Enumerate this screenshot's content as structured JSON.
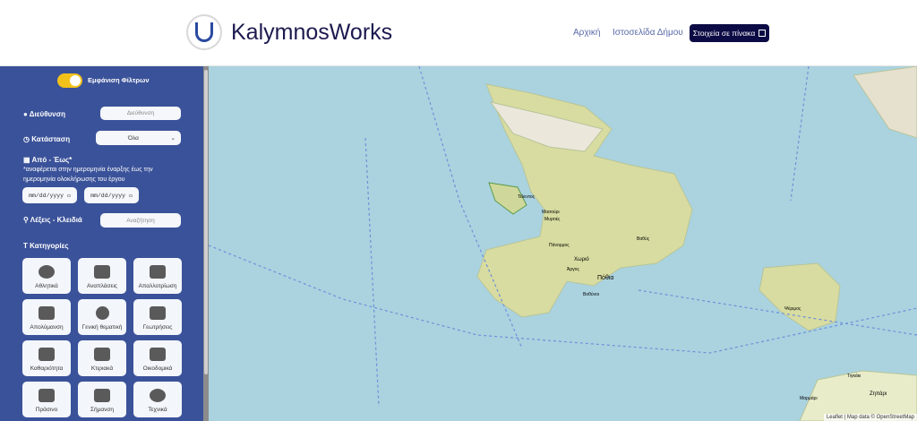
{
  "header": {
    "brand": "KalymnosWorks",
    "nav": [
      "Αρχική",
      "Ιστοσελίδα Δήμου"
    ],
    "table_button": "Στοιχεία σε πίνακα"
  },
  "filters": {
    "toggle_label": "Εμφάνιση Φίλτρων",
    "toggle_on": true,
    "address_label": "Διεύθυνση",
    "address_placeholder": "Διεύθυνση",
    "status_label": "Κατάσταση",
    "status_value": "Όλα",
    "date_label": "Από - Έως*",
    "date_note": "*αναφέρεται στην ημερομηνία έναρξης έως την ημερομηνία ολοκλήρωσης του έργου",
    "date_from_placeholder": "mm/dd/yyyy",
    "date_to_placeholder": "mm/dd/yyyy",
    "keywords_label": "Λέξεις - Κλειδιά",
    "keywords_placeholder": "Αναζήτηση",
    "categories_label": "Κατηγορίες",
    "categories": [
      "Αθλητικά",
      "Αναπλάσεις",
      "Απαλλοτρίωση",
      "Απολύμανση",
      "Γενική θεματική",
      "Γεωτρήσεις",
      "Καθαριότητα",
      "Κτιριακά",
      "Οικοδομικά",
      "Πράσινο",
      "Σήμανση",
      "Τεχνικά"
    ]
  },
  "map": {
    "labels": [
      "Τέλεντος",
      "Μασούρι",
      "Μυρτιές",
      "Πάνορμος",
      "Χωριό",
      "Άργος",
      "Πόθια",
      "Βαθύς",
      "Βοθύνοι",
      "Ψέριμος",
      "Τιγκάκι",
      "Ζηπάρι",
      "Μαρμάρι"
    ],
    "attribution": "Leaflet | Map data © OpenStreetMap"
  }
}
